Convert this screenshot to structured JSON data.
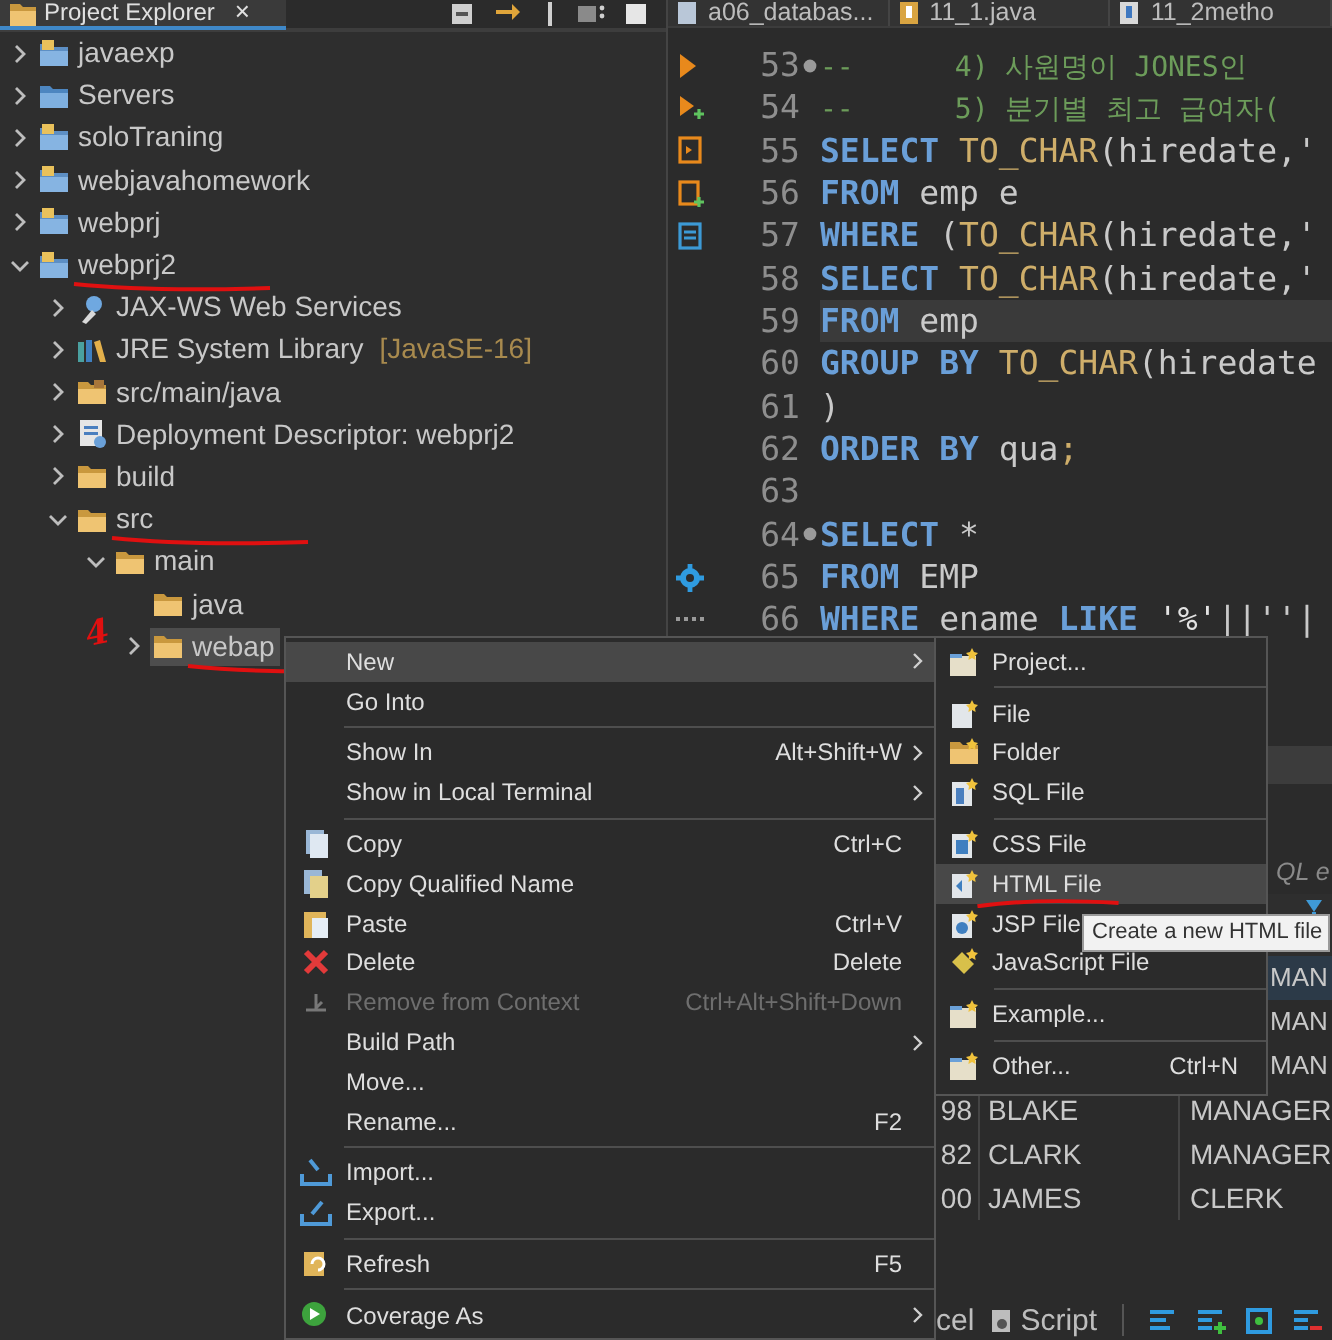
{
  "explorer": {
    "title": "Project Explorer",
    "close": "×",
    "tree": [
      {
        "label": "javaexp",
        "kind": "project",
        "expanded": false,
        "selected": false,
        "underlined": false
      },
      {
        "label": "Servers",
        "kind": "server_folder",
        "expanded": false,
        "selected": false,
        "underlined": false
      },
      {
        "label": "soloTraning",
        "kind": "project",
        "expanded": false,
        "selected": false,
        "underlined": false
      },
      {
        "label": "webjavahomework",
        "kind": "project",
        "expanded": false,
        "selected": false,
        "underlined": false
      },
      {
        "label": "webprj",
        "kind": "project",
        "expanded": false,
        "selected": false,
        "underlined": false
      },
      {
        "label": "webprj2",
        "kind": "project",
        "expanded": true,
        "selected": false,
        "underlined": true,
        "children": [
          {
            "label": "JAX-WS Web Services",
            "kind": "service",
            "expanded": false,
            "selected": false,
            "underlined": false
          },
          {
            "label": "JRE System Library",
            "decoration": "[JavaSE-16]",
            "kind": "library",
            "expanded": false,
            "selected": false,
            "underlined": false
          },
          {
            "label": "src/main/java",
            "kind": "source",
            "expanded": false,
            "selected": false,
            "underlined": false
          },
          {
            "label": "Deployment Descriptor: webprj2",
            "kind": "descriptor",
            "expanded": false,
            "selected": false,
            "underlined": false
          },
          {
            "label": "build",
            "kind": "folder",
            "expanded": false,
            "selected": false,
            "underlined": false
          },
          {
            "label": "src",
            "kind": "folder",
            "expanded": true,
            "selected": false,
            "underlined": true,
            "children": [
              {
                "label": "main",
                "kind": "folder",
                "expanded": true,
                "selected": false,
                "underlined": false,
                "children": [
                  {
                    "label": "java",
                    "kind": "folder",
                    "selected": false,
                    "underlined": false
                  },
                  {
                    "label": "webap",
                    "kind": "folder",
                    "expanded": false,
                    "selected": true,
                    "underlined": true,
                    "mark": "4"
                  }
                ]
              }
            ]
          }
        ]
      }
    ]
  },
  "editor": {
    "tabs": [
      {
        "label": "a06_databas..."
      },
      {
        "label": "11_1.java"
      },
      {
        "label": "11_2metho"
      }
    ],
    "lines": [
      {
        "number": "53",
        "fold": true,
        "current": false,
        "tokens": [
          {
            "kind": "comment",
            "text": "--      4) 사원명이 JONES인"
          }
        ]
      },
      {
        "number": "54",
        "fold": false,
        "current": false,
        "tokens": [
          {
            "kind": "comment",
            "text": "--      5) 분기별 최고 급여자("
          }
        ]
      },
      {
        "number": "55",
        "fold": false,
        "current": false,
        "tokens": [
          {
            "kind": "keyword",
            "text": "SELECT "
          },
          {
            "kind": "function",
            "text": "TO_CHAR"
          },
          {
            "kind": "plain",
            "text": "(hiredate,'"
          }
        ]
      },
      {
        "number": "56",
        "fold": false,
        "current": false,
        "tokens": [
          {
            "kind": "keyword",
            "text": "FROM"
          },
          {
            "kind": "plain",
            "text": " emp e"
          }
        ]
      },
      {
        "number": "57",
        "fold": false,
        "current": false,
        "tokens": [
          {
            "kind": "keyword",
            "text": "WHERE"
          },
          {
            "kind": "plain",
            "text": " ("
          },
          {
            "kind": "function",
            "text": "TO_CHAR"
          },
          {
            "kind": "plain",
            "text": "(hiredate,'"
          }
        ]
      },
      {
        "number": "58",
        "fold": false,
        "current": false,
        "tokens": [
          {
            "kind": "keyword",
            "text": "SELECT "
          },
          {
            "kind": "function",
            "text": "TO_CHAR"
          },
          {
            "kind": "plain",
            "text": "(hiredate,'"
          }
        ]
      },
      {
        "number": "59",
        "fold": false,
        "current": true,
        "tokens": [
          {
            "kind": "keyword",
            "text": "FROM"
          },
          {
            "kind": "plain",
            "text": " emp"
          }
        ]
      },
      {
        "number": "60",
        "fold": false,
        "current": false,
        "tokens": [
          {
            "kind": "keyword",
            "text": "GROUP BY "
          },
          {
            "kind": "function",
            "text": "TO_CHAR"
          },
          {
            "kind": "plain",
            "text": "(hiredate"
          }
        ]
      },
      {
        "number": "61",
        "fold": false,
        "current": false,
        "tokens": [
          {
            "kind": "plain",
            "text": ")"
          }
        ]
      },
      {
        "number": "62",
        "fold": false,
        "current": false,
        "tokens": [
          {
            "kind": "keyword",
            "text": "ORDER BY"
          },
          {
            "kind": "plain",
            "text": " qua"
          },
          {
            "kind": "punct",
            "text": ";"
          }
        ]
      },
      {
        "number": "63",
        "fold": false,
        "current": false
      },
      {
        "number": "64",
        "fold": true,
        "current": false,
        "tokens": [
          {
            "kind": "keyword",
            "text": "SELECT"
          },
          {
            "kind": "plain",
            "text": " *"
          }
        ]
      },
      {
        "number": "65",
        "fold": false,
        "current": false,
        "tokens": [
          {
            "kind": "keyword",
            "text": "FROM"
          },
          {
            "kind": "plain",
            "text": " EMP"
          }
        ]
      },
      {
        "number": "66",
        "fold": false,
        "current": false,
        "tokens": [
          {
            "kind": "keyword",
            "text": "WHERE"
          },
          {
            "kind": "plain",
            "text": " ename "
          },
          {
            "kind": "keyword",
            "text": "LIKE "
          },
          {
            "kind": "string",
            "text": "'%'"
          },
          {
            "kind": "plain",
            "text": "||''|"
          }
        ]
      }
    ]
  },
  "results": {
    "filter": {
      "placeholder": "QL e"
    },
    "rows": [
      {
        "job": "MAN",
        "selected": true
      },
      {
        "job": "MAN",
        "selected": false
      },
      {
        "job": "MAN",
        "selected": false
      },
      {
        "number": "98",
        "name": "BLAKE",
        "job": "MANAGER",
        "selected": false
      },
      {
        "number": "82",
        "name": "CLARK",
        "job": "MANAGER",
        "selected": false
      },
      {
        "number": "00",
        "name": "JAMES",
        "job": "CLERK",
        "selected": false
      }
    ],
    "toolbar": [
      {
        "label": "cel"
      },
      {
        "label": "Script"
      }
    ]
  },
  "context_menu": {
    "items": [
      {
        "kind": "item",
        "label": "New",
        "submenu": true,
        "selected": true,
        "disabled": false
      },
      {
        "kind": "item",
        "label": "Go Into",
        "submenu": false,
        "selected": false,
        "disabled": false
      },
      {
        "kind": "separator"
      },
      {
        "kind": "item",
        "label": "Show In",
        "shortcut": "Alt+Shift+W",
        "submenu": true,
        "selected": false,
        "disabled": false
      },
      {
        "kind": "item",
        "label": "Show in Local Terminal",
        "submenu": true,
        "selected": false,
        "disabled": false
      },
      {
        "kind": "separator"
      },
      {
        "kind": "item",
        "label": "Copy",
        "shortcut": "Ctrl+C",
        "submenu": false,
        "selected": false,
        "disabled": false
      },
      {
        "kind": "item",
        "label": "Copy Qualified Name",
        "submenu": false,
        "selected": false,
        "disabled": false
      },
      {
        "kind": "item",
        "label": "Paste",
        "shortcut": "Ctrl+V",
        "submenu": false,
        "selected": false,
        "disabled": false
      },
      {
        "kind": "item",
        "label": "Delete",
        "shortcut": "Delete",
        "submenu": false,
        "selected": false,
        "disabled": false
      },
      {
        "kind": "item",
        "label": "Remove from Context",
        "shortcut": "Ctrl+Alt+Shift+Down",
        "submenu": false,
        "selected": false,
        "disabled": true
      },
      {
        "kind": "item",
        "label": "Build Path",
        "submenu": true,
        "selected": false,
        "disabled": false
      },
      {
        "kind": "item",
        "label": "Move...",
        "submenu": false,
        "selected": false,
        "disabled": false
      },
      {
        "kind": "item",
        "label": "Rename...",
        "shortcut": "F2",
        "submenu": false,
        "selected": false,
        "disabled": false
      },
      {
        "kind": "separator"
      },
      {
        "kind": "item",
        "label": "Import...",
        "submenu": false,
        "selected": false,
        "disabled": false
      },
      {
        "kind": "item",
        "label": "Export...",
        "submenu": false,
        "selected": false,
        "disabled": false
      },
      {
        "kind": "separator"
      },
      {
        "kind": "item",
        "label": "Refresh",
        "shortcut": "F5",
        "submenu": false,
        "selected": false,
        "disabled": false
      },
      {
        "kind": "separator"
      },
      {
        "kind": "item",
        "label": "Coverage As",
        "submenu": true,
        "selected": false,
        "disabled": false
      }
    ]
  },
  "submenu": {
    "items": [
      {
        "kind": "item",
        "label": "Project...",
        "selected": false,
        "underlined": false
      },
      {
        "kind": "separator"
      },
      {
        "kind": "item",
        "label": "File",
        "selected": false,
        "underlined": false
      },
      {
        "kind": "item",
        "label": "Folder",
        "selected": false,
        "underlined": false
      },
      {
        "kind": "item",
        "label": "SQL File",
        "selected": false,
        "underlined": false
      },
      {
        "kind": "separator"
      },
      {
        "kind": "item",
        "label": "CSS File",
        "selected": false,
        "underlined": false
      },
      {
        "kind": "item",
        "label": "HTML File",
        "selected": true,
        "underlined": true
      },
      {
        "kind": "item",
        "label": "JSP File",
        "selected": false,
        "underlined": false
      },
      {
        "kind": "item",
        "label": "JavaScript File",
        "selected": false,
        "underlined": false
      },
      {
        "kind": "separator"
      },
      {
        "kind": "item",
        "label": "Example...",
        "selected": false,
        "underlined": false
      },
      {
        "kind": "separator"
      },
      {
        "kind": "item",
        "label": "Other...",
        "shortcut": "Ctrl+N",
        "selected": false,
        "underlined": false
      }
    ]
  },
  "tooltip": {
    "text": "Create a new HTML file"
  }
}
